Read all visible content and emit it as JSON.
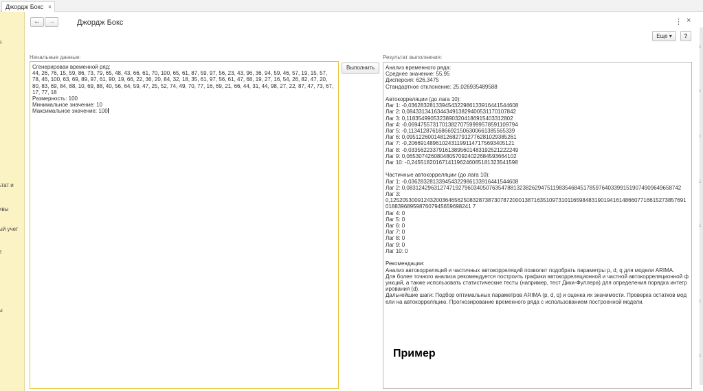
{
  "tab": {
    "title": "Джордж Бокс",
    "close": "×"
  },
  "sidebar": {
    "items": [
      "я",
      "ьтат и",
      "ивы",
      "ый учет",
      "е",
      "ы"
    ]
  },
  "header": {
    "back": "←",
    "forward": "→",
    "title": "Джордж Бокс",
    "more_menu": "⋮",
    "close": "×",
    "more_button": "Еще ▾",
    "help_button": "?"
  },
  "input": {
    "label": "Начальные данные:",
    "text": "Сгенерирован временной ряд:\n44, 26, 76, 15, 59, 86, 73, 79, 65, 48, 43, 66, 61, 70, 100, 65, 61, 87, 59, 97, 56, 23, 43, 96, 36, 94, 59, 46, 57, 19, 15, 57, 78, 46, 100, 63, 69, 89, 97, 61, 90, 19, 66, 22, 36, 20, 84, 32, 18, 35, 61, 97, 56, 61, 47, 68, 19, 27, 16, 54, 26, 82, 47, 20, 80, 83, 69, 84, 88, 10, 69, 88, 40, 56, 64, 59, 47, 25, 52, 74, 49, 70, 77, 16, 69, 21, 66, 44, 31, 44, 98, 27, 22, 87, 47, 73, 67, 17, 77, 18\nРазмерность: 100\nМинимальное значение: 10\nМаксимальное значение: 100"
  },
  "run_button": "Выполнить",
  "output": {
    "label": "Результат выполнения:",
    "text": "Анализ временного ряда:\nСреднее значение: 55,95\nДисперсия: 626,3475\nСтандартное отклонение: 25,026935489588\n\nАвтокорреляции (до лага 10):\nЛаг 1: -0,036283281339454322986133916441544608\nЛаг 2: 0,084331341634434913829400531170107842\nЛаг 3: 0,11835499053238903204186915403312802\nЛаг 4: -0,069475573170138270759999578591109794\nЛаг 5: -0,11341287616866921506300661385565339\nЛаг 6: 0,095122600148126827912776281029385261\nЛаг 7: -0,20669148961024311991147175693405121\nЛаг 8: -0,033562233791613895601483192521222249\nЛаг 9: 0,065307426080480570924022684593664102\nЛаг 10: -0,24551820167141196246065181323541598\n\nЧастичные автокорреляции (до лага 10):\nЛаг 1: -0,036283281339454322986133916441544608\nЛаг 2: 0,083124296312747192796034050763547881323826294751198354684517859764033991519074909649658742\nЛаг 3:\n0,12520530091243200364656250832873873078720001387163510973101165984831901941614866077166152738576910188396895987607945659698241 7\nЛаг 4: 0\nЛаг 5: 0\nЛаг 6: 0\nЛаг 7: 0\nЛаг 8: 0\nЛаг 9: 0\nЛаг 10: 0\n\nРекомендации:\nАнализ автокорреляций и частичных автокорреляций позволит подобрать параметры p, d, q для модели ARIMA.\nДля более точного анализа рекомендуется построить графики автокорреляционной и частной автокорреляционной функций, а также использовать статистические тесты (например, тест Дики-Фуллера) для определения порядка интегрирования (d).\nДальнейшие шаги: Подбор оптимальных параметров ARIMA (p, d, q) и оценка их значимости. Проверка остатков модели на автокорреляцию. Прогнозирование временного ряда с использованием построенной модели."
  },
  "watermark": "Пример",
  "right_marks": [
    "1",
    "1",
    "1",
    "1",
    "1",
    "1",
    "1"
  ]
}
